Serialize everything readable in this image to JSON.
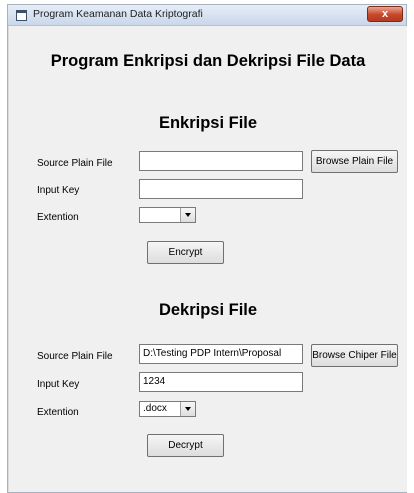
{
  "window": {
    "title": "Program Keamanan Data Kriptografi",
    "close_label": "x"
  },
  "main_title": "Program Enkripsi dan Dekripsi File Data",
  "encrypt": {
    "section_title": "Enkripsi File",
    "source_label": "Source Plain File",
    "source_value": "",
    "browse_label": "Browse Plain File",
    "key_label": "Input Key",
    "key_value": "",
    "extension_label": "Extention",
    "extension_value": "",
    "action_label": "Encrypt"
  },
  "decrypt": {
    "section_title": "Dekripsi File",
    "source_label": "Source Plain File",
    "source_value": "D:\\Testing PDP Intern\\Proposal",
    "browse_label": "Browse Chiper File",
    "key_label": "Input Key",
    "key_value": "1234",
    "extension_label": "Extention",
    "extension_value": ".docx",
    "action_label": "Decrypt"
  }
}
